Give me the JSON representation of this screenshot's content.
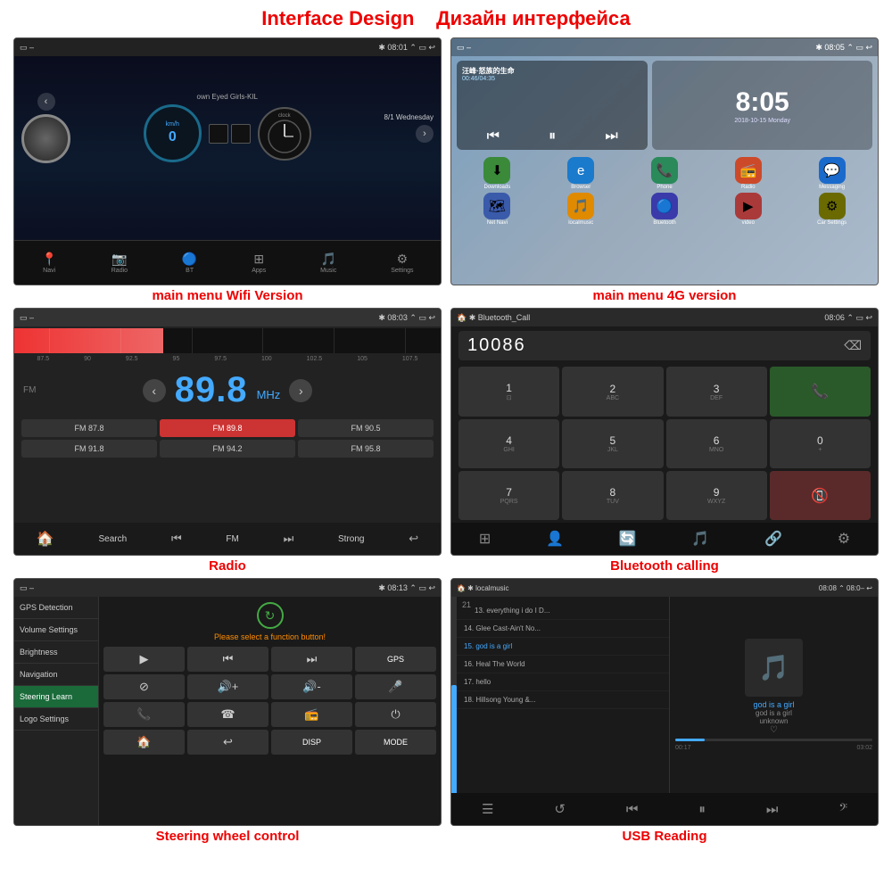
{
  "page": {
    "title_en": "Interface Design",
    "title_ru": "Дизайн интерфейса"
  },
  "cells": [
    {
      "id": "s1",
      "caption": "main menu Wifi Version",
      "topbar": {
        "time": "08:01"
      },
      "song": "own Eyed Girls-KIL",
      "date": "8/1 Wednesday",
      "bottom_items": [
        "Navi",
        "Radio",
        "BT",
        "Apps",
        "Music",
        "Settings"
      ]
    },
    {
      "id": "s2",
      "caption": "main menu 4G version",
      "topbar": {
        "time": "08:05"
      },
      "big_time": "8:05",
      "date": "2018-10-15 Monday",
      "music_title": "汪峰·怒族的生命",
      "music_time": "00:46/04:35",
      "apps": [
        "Downloads",
        "Browser",
        "Phone",
        "Radio",
        "Messaging",
        "Net Navi",
        "localmusic",
        "Bluetooth",
        "video",
        "Car Settings"
      ]
    },
    {
      "id": "s3",
      "caption": "Radio",
      "topbar": {
        "time": "08:03"
      },
      "freq": "89.8",
      "unit": "MHz",
      "band": "FM",
      "scale": [
        "87.5",
        "90",
        "92.5",
        "95",
        "97.5",
        "100",
        "102.5",
        "105",
        "107.5"
      ],
      "presets": [
        "FM 87.8",
        "FM 89.8",
        "FM 90.5",
        "FM 91.8",
        "FM 94.2",
        "FM 95.8"
      ],
      "bottom": [
        "home",
        "Search",
        "prev",
        "FM",
        "next",
        "Strong",
        "back"
      ]
    },
    {
      "id": "s4",
      "caption": "Bluetooth calling",
      "topbar": {
        "time": "08:06",
        "title": "Bluetooth_Call"
      },
      "number": "10086",
      "keys": [
        "1",
        "2 ABC",
        "3 DEF",
        "*",
        "4 GHI",
        "5 JKL",
        "6 MNO",
        "0 +",
        "7 PQRS",
        "8 TUV",
        "9 WXYZ",
        "#"
      ]
    },
    {
      "id": "s5",
      "caption": "Steering wheel control",
      "topbar": {
        "time": "08:13"
      },
      "prompt": "Please select a function button!",
      "sidebar_items": [
        "GPS Detection",
        "Volume Settings",
        "Brightness",
        "Navigation",
        "Steering Learn",
        "Logo Settings"
      ],
      "active_item": "Steering Learn",
      "ctrl_labels": [
        "▶",
        "⏮",
        "⏭",
        "GPS",
        "⊘",
        "🔊+",
        "🔊-",
        "🎤",
        "📞",
        "☎↩",
        "📻",
        "⏻",
        "🏠",
        "↩",
        "DISP",
        "MODE"
      ]
    },
    {
      "id": "s6",
      "caption": "USB Reading",
      "topbar": {
        "time": "08:08",
        "source": "localmusic"
      },
      "playlist": [
        {
          "num": "13.",
          "title": "everything i do I D...",
          "active": false
        },
        {
          "num": "14.",
          "title": "Glee Cast-Ain't No...",
          "active": false
        },
        {
          "num": "15.",
          "title": "god is a girl",
          "active": true
        },
        {
          "num": "16.",
          "title": "Heal The World",
          "active": false
        },
        {
          "num": "17.",
          "title": "hello",
          "active": false
        },
        {
          "num": "18.",
          "title": "Hillsong Young &...",
          "active": false
        }
      ],
      "current_song": "god is a girl",
      "side_info": [
        "god is a girl",
        "unknown",
        "♡"
      ],
      "time_current": "00:17",
      "time_total": "03:02"
    }
  ]
}
